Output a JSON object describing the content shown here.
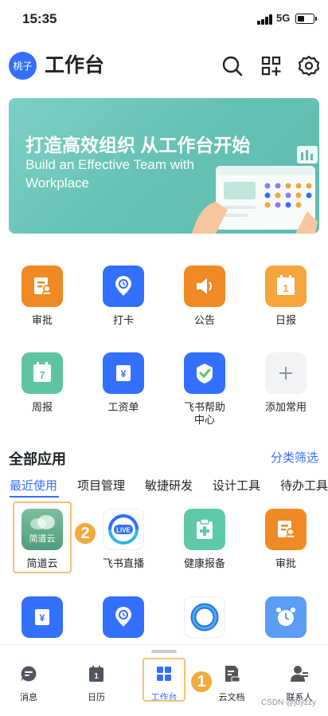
{
  "status": {
    "time": "15:35",
    "network": "5G"
  },
  "header": {
    "avatar_text": "桃子",
    "title": "工作台"
  },
  "banner": {
    "title": "打造高效组织 从工作台开始",
    "subtitle": "Build an Effective Team with Workplace"
  },
  "quick_apps": [
    {
      "label": "审批",
      "icon": "approval-icon",
      "color": "#f08a24"
    },
    {
      "label": "打卡",
      "icon": "check-in-icon",
      "color": "#3370ff"
    },
    {
      "label": "公告",
      "icon": "announcement-icon",
      "color": "#f08a24"
    },
    {
      "label": "日报",
      "icon": "daily-report-icon",
      "color": "#f5a53b"
    },
    {
      "label": "周报",
      "icon": "weekly-report-icon",
      "color": "#5fc4a4"
    },
    {
      "label": "工资单",
      "icon": "payslip-icon",
      "color": "#3370ff"
    },
    {
      "label": "飞书帮助中心",
      "icon": "help-center-icon",
      "color": "#3370ff"
    },
    {
      "label": "添加常用",
      "icon": "add-icon",
      "color": "#f2f3f5"
    }
  ],
  "all_apps": {
    "title": "全部应用",
    "filter_label": "分类筛选"
  },
  "tabs": [
    "最近使用",
    "项目管理",
    "敏捷研发",
    "设计工具",
    "待办工具"
  ],
  "recent_apps": [
    {
      "label": "简道云",
      "icon": "jiandaoyun-icon",
      "inner_text": "简道云"
    },
    {
      "label": "飞书直播",
      "icon": "live-icon",
      "inner_text": "LIVE"
    },
    {
      "label": "健康报备",
      "icon": "health-report-icon"
    },
    {
      "label": "审批",
      "icon": "approval-icon"
    }
  ],
  "annotations": {
    "one": "1",
    "two": "2"
  },
  "bottom_nav": [
    {
      "label": "消息",
      "icon": "message-icon"
    },
    {
      "label": "日历",
      "icon": "calendar-icon"
    },
    {
      "label": "工作台",
      "icon": "workplace-icon",
      "active": true
    },
    {
      "label": "云文档",
      "icon": "docs-icon"
    },
    {
      "label": "联系人",
      "icon": "contacts-icon"
    }
  ],
  "watermark": "CSDN @jdyzzy"
}
